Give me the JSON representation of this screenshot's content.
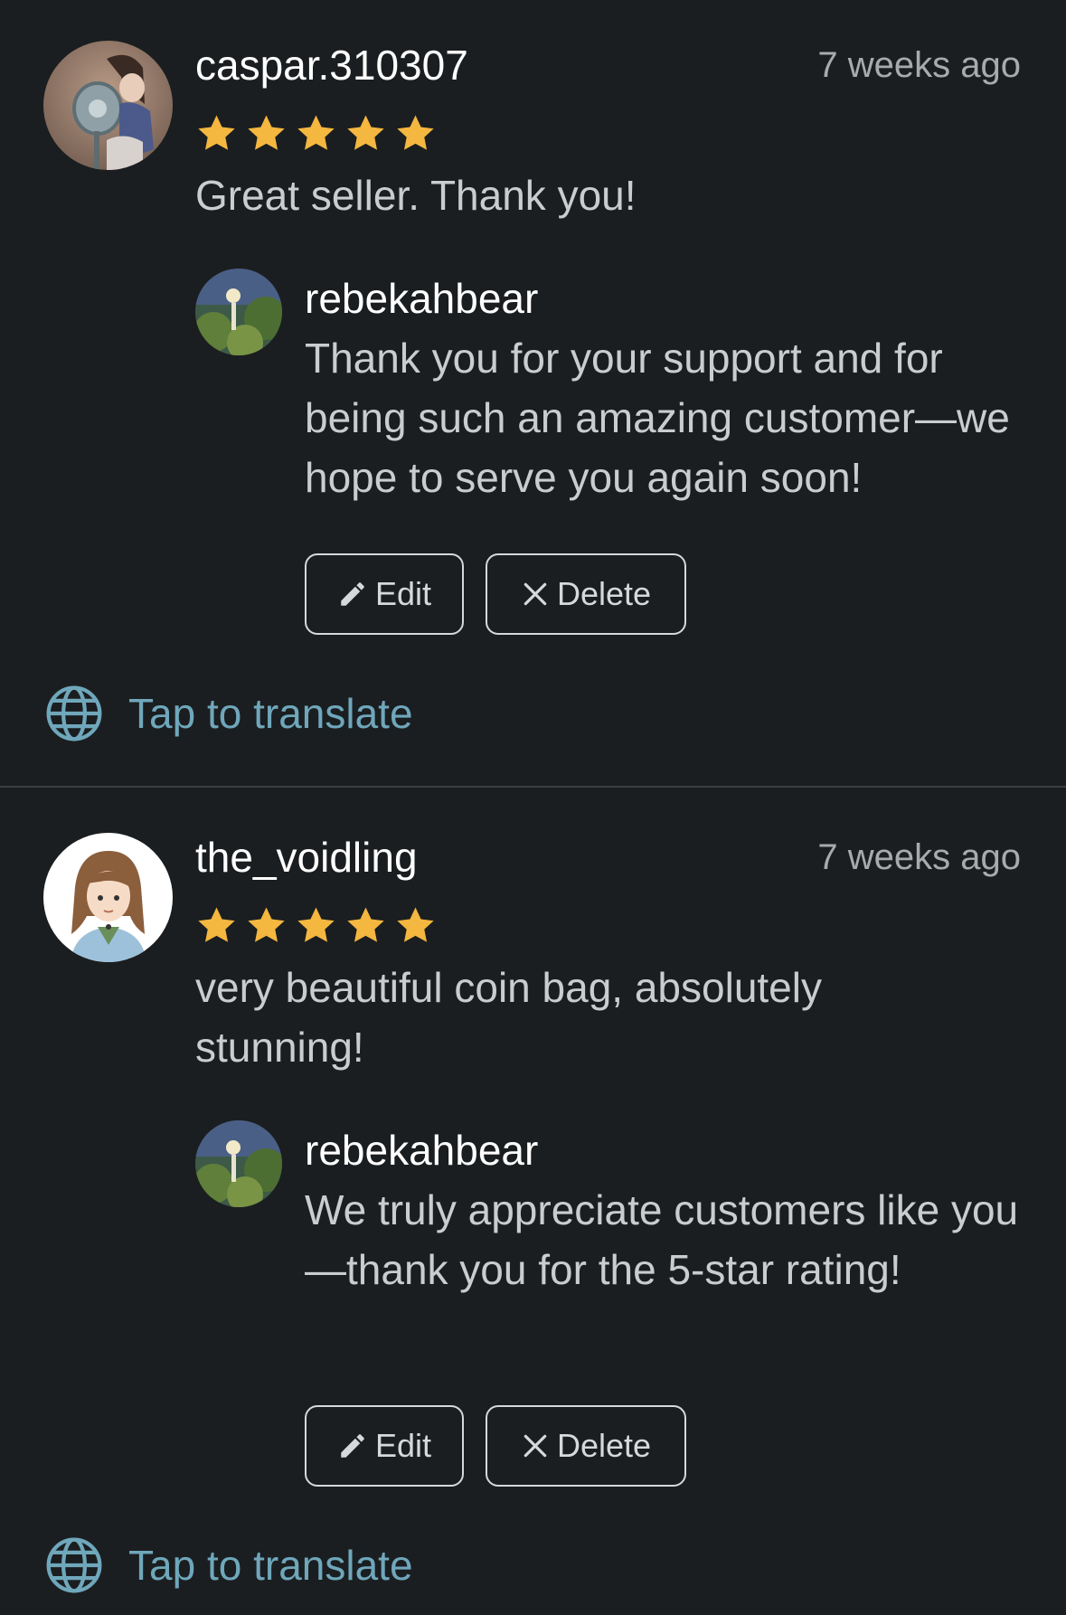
{
  "colors": {
    "background": "#1b1e20",
    "star": "#f4b73f",
    "translate_link": "#6fa7bb",
    "divider": "#3b3f42"
  },
  "reviews": [
    {
      "username": "caspar.310307",
      "timestamp": "7 weeks ago",
      "rating": 5,
      "rating_max": 5,
      "text": "Great seller. Thank you!",
      "reply": {
        "name": "rebekahbear",
        "text": "Thank you for your support and for being such an amazing customer—we hope to serve you again soon!"
      },
      "actions": {
        "edit_label": "Edit",
        "edit_icon": "pencil-icon",
        "delete_label": "Delete",
        "delete_icon": "close-icon"
      },
      "translate": {
        "label": "Tap to translate",
        "icon": "globe-icon"
      }
    },
    {
      "username": "the_voidling",
      "timestamp": "7 weeks ago",
      "rating": 5,
      "rating_max": 5,
      "text": "very beautiful coin bag, absolutely stunning!",
      "reply": {
        "name": "rebekahbear",
        "text": "We truly appreciate customers like you—thank you for the 5-star rating!"
      },
      "actions": {
        "edit_label": "Edit",
        "edit_icon": "pencil-icon",
        "delete_label": "Delete",
        "delete_icon": "close-icon"
      },
      "translate": {
        "label": "Tap to translate",
        "icon": "globe-icon"
      }
    }
  ]
}
